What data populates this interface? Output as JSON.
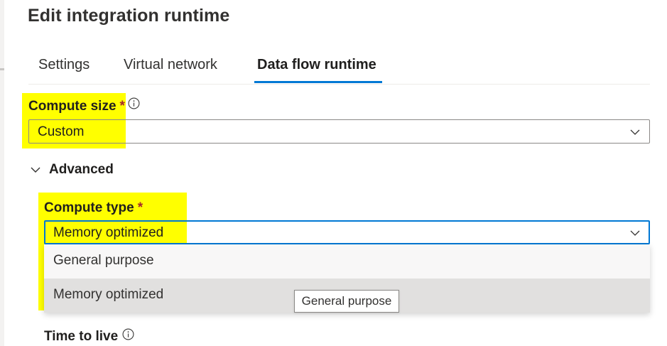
{
  "panel": {
    "title": "Edit integration runtime"
  },
  "tabs": [
    {
      "label": "Settings"
    },
    {
      "label": "Virtual network"
    },
    {
      "label": "Data flow runtime",
      "active": true
    }
  ],
  "compute_size": {
    "label": "Compute size",
    "required_marker": "*",
    "value": "Custom",
    "info_icon": "info-circle-icon"
  },
  "advanced": {
    "label": "Advanced",
    "expanded": true
  },
  "compute_type": {
    "label": "Compute type",
    "required_marker": "*",
    "value": "Memory optimized",
    "options": [
      {
        "label": "General purpose"
      },
      {
        "label": "Memory optimized",
        "selected": true
      }
    ],
    "tooltip": "General purpose"
  },
  "time_to_live": {
    "label": "Time to live",
    "info_icon": "info-circle-icon"
  },
  "colors": {
    "accent": "#0078d4",
    "highlight": "#ffff00",
    "required": "#a4262c"
  }
}
